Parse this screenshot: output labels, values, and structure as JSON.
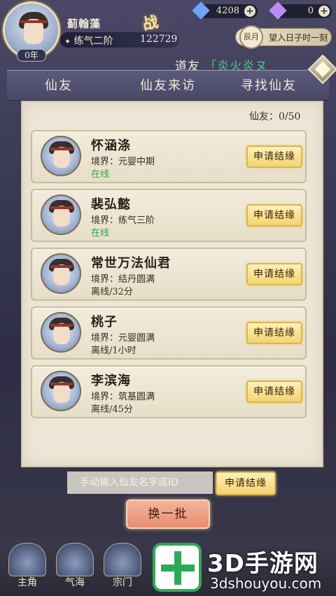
{
  "player": {
    "name": "蓟翰藻",
    "realm": "练气二阶",
    "level": "0年",
    "power_label": "战",
    "power": "122729"
  },
  "currencies": [
    {
      "name": "spirit-stone",
      "value": "4208",
      "color": "#6fa3ff"
    },
    {
      "name": "jade",
      "value": "0",
      "color": "#b98df2"
    }
  ],
  "time": {
    "badge": "辰月",
    "text": "望入日子时一刻"
  },
  "header": {
    "prefix": "道友",
    "bracket": "「",
    "nickname": "炎火炎ヌ"
  },
  "tabs": [
    {
      "label": "仙友"
    },
    {
      "label": "仙友来访"
    },
    {
      "label": "寻找仙友"
    }
  ],
  "friend_count": "仙友：0/50",
  "friends": [
    {
      "name": "怀涵涤",
      "realm": "境界：元婴中期",
      "status": "在线",
      "online": true,
      "action": "申请结缘"
    },
    {
      "name": "裴弘懿",
      "realm": "境界：练气三阶",
      "status": "在线",
      "online": true,
      "action": "申请结缘"
    },
    {
      "name": "常世万法仙君",
      "realm": "境界：结丹圆满",
      "status": "离线/32分",
      "online": false,
      "action": "申请结缘"
    },
    {
      "name": "桃子",
      "realm": "境界：元婴圆满",
      "status": "离线/1小时",
      "online": false,
      "action": "申请结缘"
    },
    {
      "name": "李滨海",
      "realm": "境界：筑基圆满",
      "status": "离线/45分",
      "online": false,
      "action": "申请结缘"
    }
  ],
  "search": {
    "placeholder": "手动输入仙友名字或ID",
    "apply_label": "申请结缘"
  },
  "refresh_label": "换一批",
  "bottom_nav": [
    {
      "label": "主角"
    },
    {
      "label": "气海"
    },
    {
      "label": "宗门"
    }
  ],
  "watermark": {
    "title": "3D手游网",
    "url": "3dshouyou.com"
  }
}
